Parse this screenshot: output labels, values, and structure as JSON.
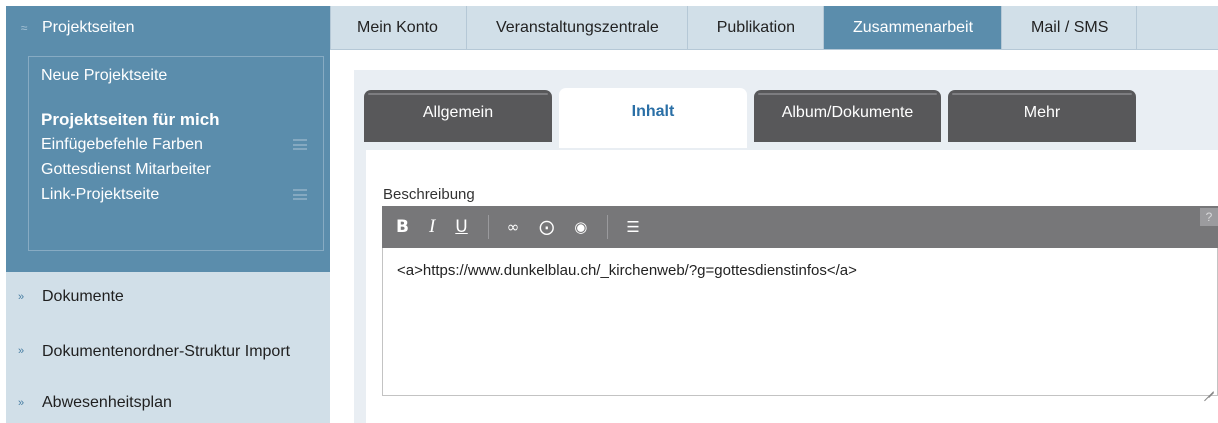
{
  "sidebar": {
    "header": {
      "label": "Projektseiten",
      "icon": "collapse-icon"
    },
    "subitems": [
      {
        "label": "Neue Projektseite",
        "bold": false,
        "draggable": false
      },
      {
        "label": "Projektseiten für mich",
        "bold": true,
        "draggable": false
      },
      {
        "label": "Einfügebefehle Farben",
        "bold": false,
        "draggable": true
      },
      {
        "label": "Gottesdienst Mitarbeiter",
        "bold": false,
        "draggable": false
      },
      {
        "label": "Link-Projektseite",
        "bold": false,
        "draggable": true
      }
    ],
    "items": [
      {
        "label": "Dokumente",
        "icon": "expand-icon"
      },
      {
        "label": "Dokumentenordner-Struktur Import",
        "icon": "expand-icon"
      },
      {
        "label": "Abwesenheitsplan",
        "icon": "expand-icon"
      }
    ]
  },
  "topnav": {
    "tabs": [
      {
        "label": "Mein Konto"
      },
      {
        "label": "Veranstaltungszentrale"
      },
      {
        "label": "Publikation"
      },
      {
        "label": "Zusammenarbeit",
        "active": true
      },
      {
        "label": "Mail / SMS"
      }
    ]
  },
  "subtabs": [
    {
      "label": "Allgemein"
    },
    {
      "label": "Inhalt",
      "active": true
    },
    {
      "label": "Album/Dokumente"
    },
    {
      "label": "Mehr"
    }
  ],
  "editor": {
    "label": "Beschreibung",
    "content": "<a>https://www.dunkelblau.ch/_kirchenweb/?g=gottesdienstinfos</a>",
    "help": "?",
    "toolbar": {
      "bold": "B",
      "italic": "I",
      "underline": "U",
      "link_icon": "link-icon",
      "attach_icon": "paperclip-icon",
      "map_icon": "map-pin-icon",
      "list_icon": "list-icon"
    }
  },
  "colors": {
    "sidebar_dark": "#5b8dac",
    "sidebar_light": "#d1dfe8",
    "tab_dark": "#58585a",
    "toolbar": "#777779",
    "active_tab_text": "#2a6fa6"
  }
}
